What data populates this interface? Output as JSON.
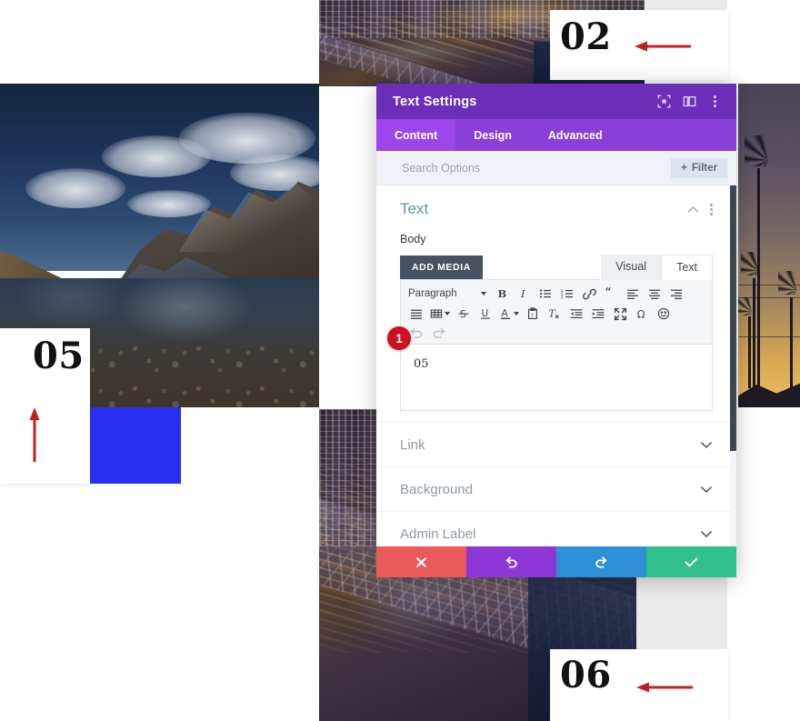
{
  "modal": {
    "title": "Text Settings",
    "header_icons": [
      {
        "name": "focus-target-icon",
        "label": "Focus"
      },
      {
        "name": "layout-panel-icon",
        "label": "Layout"
      },
      {
        "name": "more-options-icon",
        "label": "More"
      }
    ],
    "tabs": [
      {
        "label": "Content",
        "active": true
      },
      {
        "label": "Design",
        "active": false
      },
      {
        "label": "Advanced",
        "active": false
      }
    ],
    "search": {
      "placeholder": "Search Options",
      "value": ""
    },
    "filter_button": "Filter",
    "filter_icon": "+",
    "section": {
      "title": "Text",
      "collapse_icon": "chevron-up-icon",
      "more_icon": "more-options-icon",
      "field_label": "Body",
      "add_media_label": "ADD MEDIA",
      "editor_tabs": [
        {
          "label": "Visual",
          "active": true
        },
        {
          "label": "Text",
          "active": false
        }
      ],
      "format_select": "Paragraph",
      "toolbar_row1": [
        "bold-icon",
        "italic-icon",
        "bulleted-list-icon",
        "numbered-list-icon",
        "link-icon",
        "blockquote-icon",
        "align-left-icon",
        "align-center-icon",
        "align-right-icon"
      ],
      "toolbar_row2": [
        "align-justify-icon",
        "table-icon",
        "strikethrough-icon",
        "underline-icon",
        "text-color-icon",
        "paste-as-text-icon",
        "clear-formatting-icon",
        "outdent-icon",
        "indent-icon",
        "fullscreen-icon",
        "special-character-icon",
        "emoji-icon"
      ],
      "toolbar_row3": [
        "undo-icon",
        "redo-icon"
      ],
      "editor_value": "05"
    },
    "accordions": [
      {
        "label": "Link",
        "icon": "chevron-down-icon"
      },
      {
        "label": "Background",
        "icon": "chevron-down-icon"
      },
      {
        "label": "Admin Label",
        "icon": "chevron-down-icon"
      }
    ],
    "footer_buttons": [
      {
        "name": "cancel-button",
        "icon": "close-x-icon",
        "color": "#ea5a5a"
      },
      {
        "name": "undo-button",
        "icon": "undo-arrow-icon",
        "color": "#8c37d6"
      },
      {
        "name": "redo-button",
        "icon": "redo-arrow-icon",
        "color": "#2d8fd5"
      },
      {
        "name": "save-button",
        "icon": "checkmark-icon",
        "color": "#2fc08b"
      }
    ]
  },
  "annotations": {
    "step_badge": "1",
    "callouts": [
      {
        "number": "02",
        "arrow": "left"
      },
      {
        "number": "05",
        "arrow": "up"
      },
      {
        "number": "06",
        "arrow": "left"
      }
    ]
  },
  "colors": {
    "modal_header": "#6c2eb9",
    "tab_bar": "#8b3fd9",
    "tab_active": "#9b46e8",
    "badge_red": "#cf1020",
    "arrow_red": "#c42020",
    "blue_square": "#2a2ef0"
  },
  "photos": [
    {
      "name": "city-bridge-night-top",
      "alt": "Aerial night view of bridge with traffic"
    },
    {
      "name": "mountain-lake",
      "alt": "Mountain lake with clouds reflected"
    },
    {
      "name": "palm-trees-sunset",
      "alt": "Palm tree silhouettes at sunset"
    },
    {
      "name": "city-bridge-night-bottom",
      "alt": "Aerial night view of bridge with city lights"
    }
  ]
}
